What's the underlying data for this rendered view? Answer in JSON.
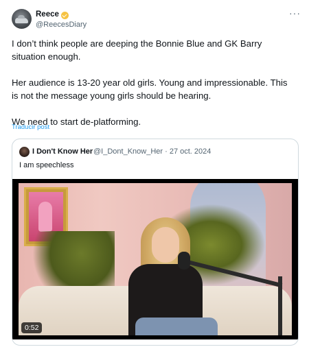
{
  "post": {
    "author_name": "Reece",
    "author_handle": "@ReecesDiary",
    "more_icon": "more-horizontal-icon",
    "verified_icon": "gold-verified-badge-icon",
    "paragraphs": [
      "I don’t think people are deeping the Bonnie Blue and GK Barry situation enough.",
      "Her audience is 13-20 year old girls. Young and impressionable. This is not the message young girls should be hearing.",
      "We need to start de-platforming."
    ],
    "translate_label": "Traducir post"
  },
  "quote": {
    "author_name": "I Don't Know Her",
    "meta": "@I_Dont_Know_Her · 27 oct. 2024",
    "text": "I am speechless",
    "video": {
      "duration": "0:52"
    }
  },
  "colors": {
    "link": "#1d9bf0",
    "secondary_text": "#536471",
    "border": "#cfd9de",
    "verified": "#f6c343"
  }
}
